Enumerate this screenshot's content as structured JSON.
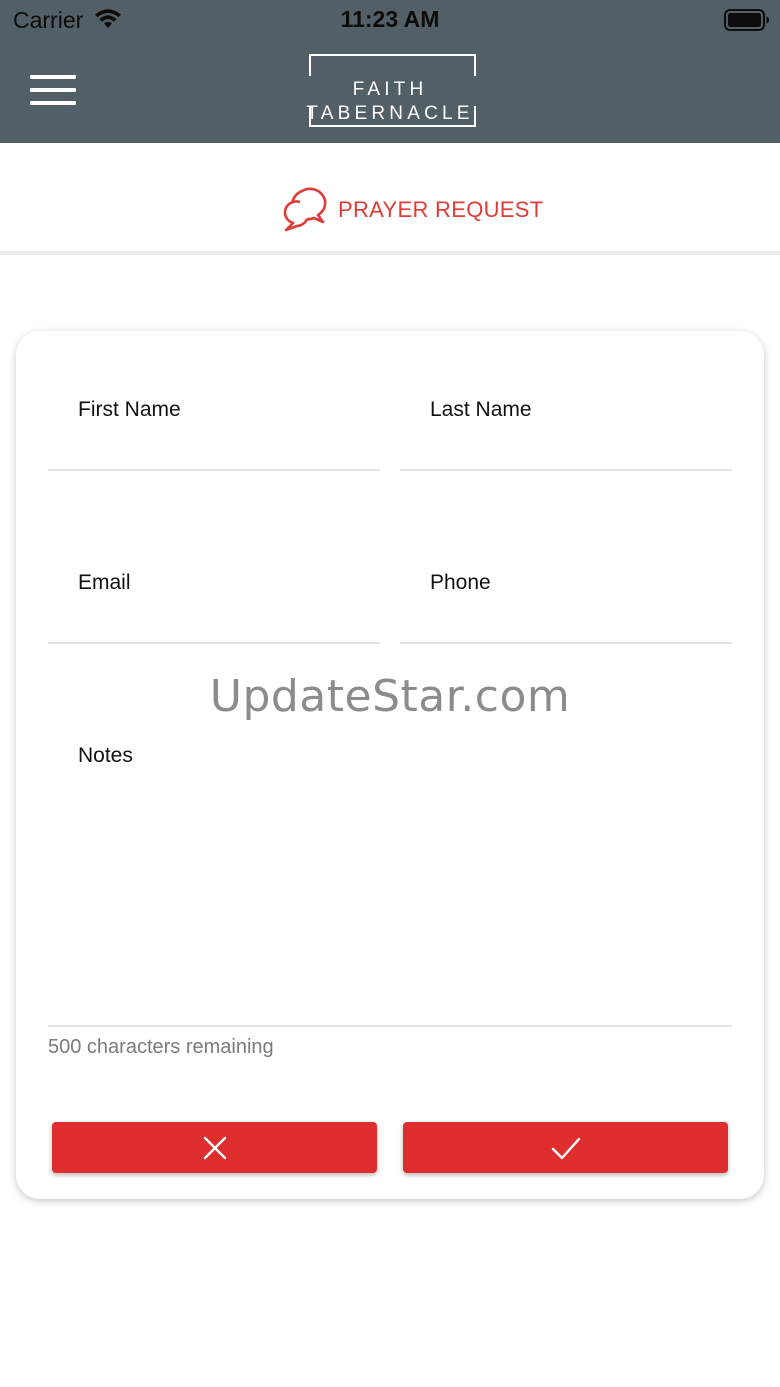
{
  "status_bar": {
    "carrier": "Carrier",
    "time": "11:23 AM"
  },
  "header": {
    "logo_text": "FAITH TABERNACLE",
    "background": "#535f66"
  },
  "section": {
    "icon": "chat-bubbles-icon",
    "title": "PRAYER REQUEST",
    "accent": "#e03c37"
  },
  "form": {
    "first_name_label": "First Name",
    "first_name_value": "",
    "last_name_label": "Last Name",
    "last_name_value": "",
    "email_label": "Email",
    "email_value": "",
    "phone_label": "Phone",
    "phone_value": "",
    "notes_label": "Notes",
    "notes_value": "",
    "counter_text": "500 characters remaining"
  },
  "actions": {
    "cancel_icon": "close-icon",
    "submit_icon": "checkmark-icon",
    "button_color": "#df2e2e"
  },
  "watermark": "UpdateStar.com"
}
